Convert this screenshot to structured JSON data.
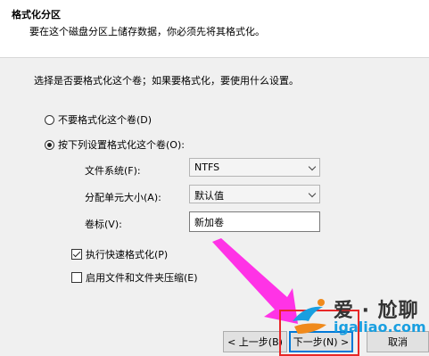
{
  "header": {
    "title": "格式化分区",
    "subtitle": "要在这个磁盘分区上储存数据，你必须先将其格式化。"
  },
  "instruction": "选择是否要格式化这个卷；如果要格式化，要使用什么设置。",
  "options": {
    "no_format_label": "不要格式化这个卷(D)",
    "format_label": "按下列设置格式化这个卷(O):"
  },
  "fields": {
    "filesystem_label": "文件系统(F):",
    "filesystem_value": "NTFS",
    "allocation_label": "分配单元大小(A):",
    "allocation_value": "默认值",
    "volume_label_label": "卷标(V):",
    "volume_label_value": "新加卷"
  },
  "checkboxes": {
    "quick_format": "执行快速格式化(P)",
    "compression": "启用文件和文件夹压缩(E)"
  },
  "buttons": {
    "back": "< 上一步(B)",
    "next": "下一步(N) >",
    "cancel": "取消"
  },
  "watermark": {
    "cn": "爱 · 尬聊",
    "en": "igaliao.com"
  },
  "colors": {
    "arrow": "#ff33e6",
    "highlight": "#e82828"
  }
}
